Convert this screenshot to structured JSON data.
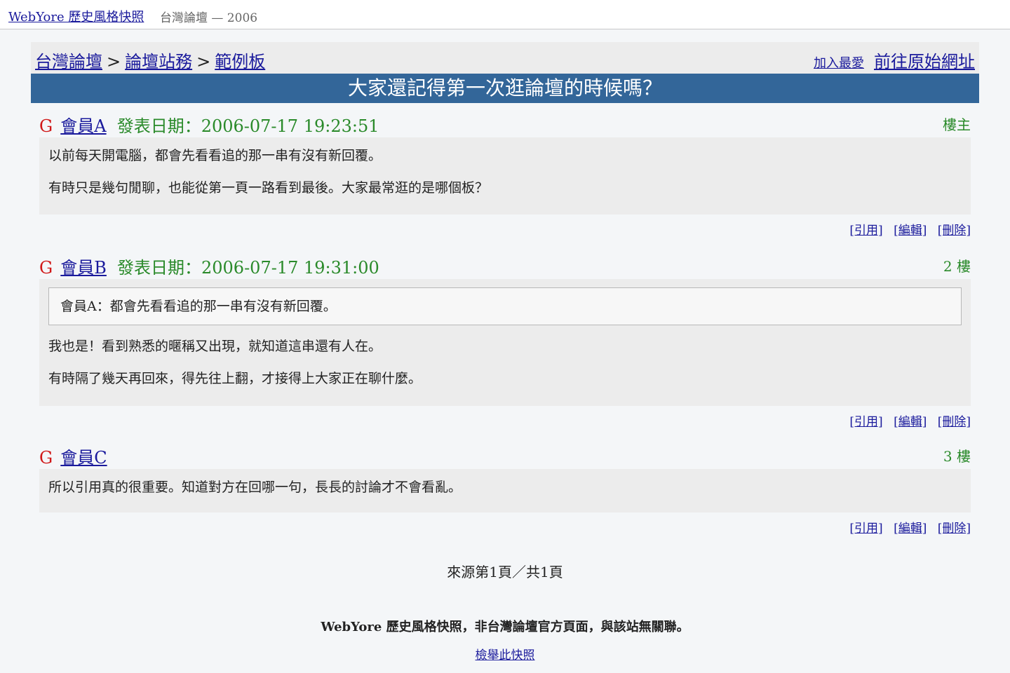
{
  "topbar": {
    "brand": "WebYore 歷史風格快照",
    "subtitle": "台灣論壇 — 2006"
  },
  "breadcrumb": {
    "items": [
      "台灣論壇",
      "論壇站務",
      "範例板"
    ],
    "separator": ">",
    "favorite": "加入最愛",
    "original": "前往原始網址"
  },
  "thread": {
    "title": "大家還記得第一次逛論壇的時候嗎？"
  },
  "posts": [
    {
      "marker": "G",
      "author": "會員A",
      "date": "發表日期：2006-07-17 19:23:51",
      "floor": "樓主",
      "paragraphs": [
        "以前每天開電腦，都會先看看追的那一串有沒有新回覆。",
        "有時只是幾句閒聊，也能從第一頁一路看到最後。大家最常逛的是哪個板？"
      ]
    },
    {
      "marker": "G",
      "author": "會員B",
      "date": "發表日期：2006-07-17 19:31:00",
      "floor": "2 樓",
      "quote": "會員A：都會先看看追的那一串有沒有新回覆。",
      "paragraphs": [
        "我也是！看到熟悉的暱稱又出現，就知道這串還有人在。",
        "有時隔了幾天再回來，得先往上翻，才接得上大家正在聊什麼。"
      ]
    },
    {
      "marker": "G",
      "author": "會員C",
      "floor": "3 樓",
      "paragraphs": [
        "所以引用真的很重要。知道對方在回哪一句，長長的討論才不會看亂。"
      ]
    }
  ],
  "actions": {
    "quote": "[引用]",
    "edit": "[編輯]",
    "delete": "[刪除]"
  },
  "pager": "來源第1頁／共1頁",
  "footer": {
    "note": "WebYore 歷史風格快照，非台灣論壇官方頁面，與該站無關聯。",
    "report": "檢舉此快照"
  },
  "colors": {
    "banner": "#336699",
    "marker": "#d01818",
    "date": "#2a8a2a",
    "link": "#1a1a9c"
  }
}
